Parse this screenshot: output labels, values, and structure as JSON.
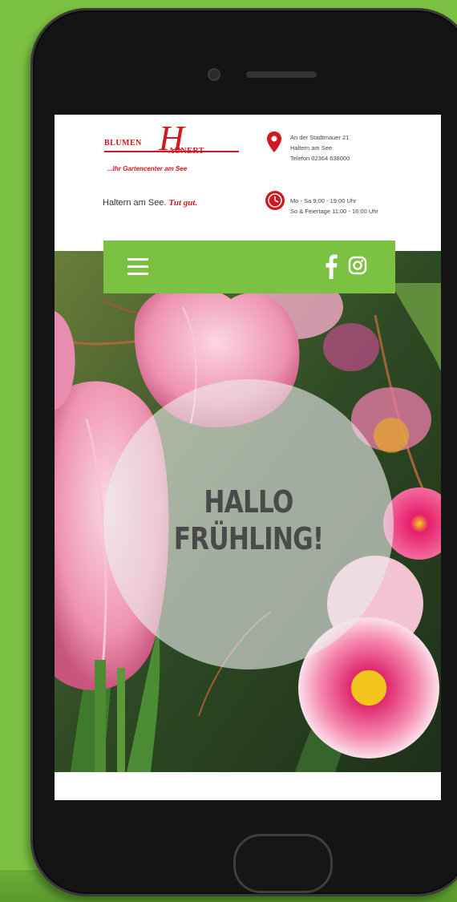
{
  "brand": {
    "logo_left": "BLUMEN",
    "logo_letter": "H",
    "logo_right": "AUNERT",
    "tagline": "...Ihr Gartencenter am See"
  },
  "slogan": {
    "town": "Haltern am See.",
    "script": "Tut gut."
  },
  "contact": {
    "address_line1": "An der Stadtmauer 21",
    "address_line2": "Haltern am See",
    "phone": "Telefon 02364 638000",
    "hours_line1": "Mo - Sa 9:00 - 19:00 Uhr",
    "hours_line2": "So & Feiertage 11:00 - 16:00 Uhr"
  },
  "hero": {
    "title_line1": "HALLO",
    "title_line2": "FRÜHLING!"
  },
  "icons": {
    "menu": "hamburger-menu-icon",
    "facebook": "facebook-icon",
    "instagram": "instagram-icon",
    "location": "map-pin-icon",
    "clock": "clock-icon"
  },
  "colors": {
    "background": "#7cc242",
    "brand_red": "#d0181e",
    "nav_green": "#7cc242"
  }
}
